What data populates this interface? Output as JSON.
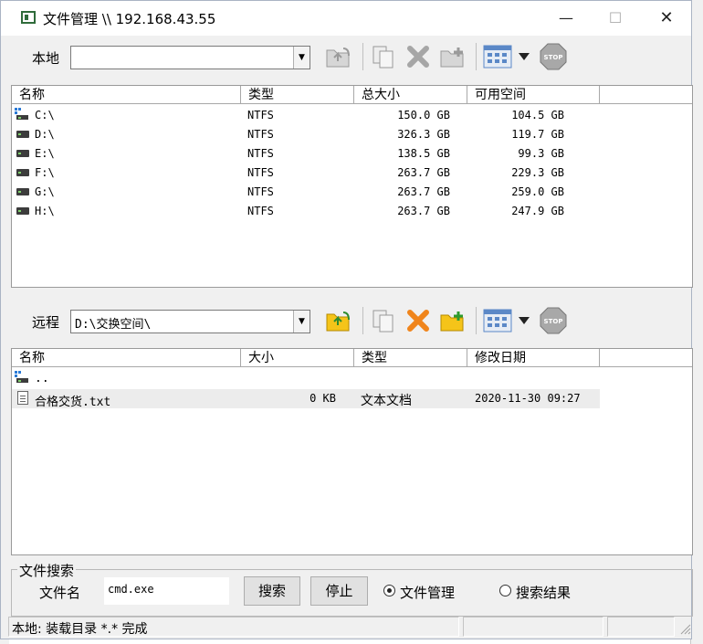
{
  "window": {
    "title": "文件管理 \\\\ 192.168.43.55",
    "minimize": "—",
    "maximize": "☐",
    "close": "✕"
  },
  "local": {
    "label": "本地",
    "path": "",
    "columns": [
      "名称",
      "类型",
      "总大小",
      "可用空间"
    ],
    "rows": [
      {
        "name": "C:\\",
        "type": "NTFS",
        "total": "150.0 GB",
        "free": "104.5 GB",
        "icon": "network-drive-icon"
      },
      {
        "name": "D:\\",
        "type": "NTFS",
        "total": "326.3 GB",
        "free": "119.7 GB",
        "icon": "drive-icon"
      },
      {
        "name": "E:\\",
        "type": "NTFS",
        "total": "138.5 GB",
        "free": "99.3 GB",
        "icon": "drive-icon"
      },
      {
        "name": "F:\\",
        "type": "NTFS",
        "total": "263.7 GB",
        "free": "229.3 GB",
        "icon": "drive-icon"
      },
      {
        "name": "G:\\",
        "type": "NTFS",
        "total": "263.7 GB",
        "free": "259.0 GB",
        "icon": "drive-icon"
      },
      {
        "name": "H:\\",
        "type": "NTFS",
        "total": "263.7 GB",
        "free": "247.9 GB",
        "icon": "drive-icon"
      }
    ]
  },
  "remote": {
    "label": "远程",
    "path": "D:\\交换空间\\",
    "columns": [
      "名称",
      "大小",
      "类型",
      "修改日期"
    ],
    "rows": [
      {
        "name": "..",
        "size": "",
        "type": "",
        "date": "",
        "icon": "parent-folder-icon"
      },
      {
        "name": "合格交货.txt",
        "size": "0 KB",
        "type": "文本文档",
        "date": "2020-11-30 09:27",
        "icon": "text-file-icon"
      }
    ]
  },
  "toolbar_icons": [
    "folder-up-icon",
    "copy-icon",
    "delete-icon",
    "new-folder-icon",
    "view-icon",
    "stop-icon"
  ],
  "search": {
    "legend": "文件搜索",
    "filename_label": "文件名",
    "filename_value": "cmd.exe",
    "search_button": "搜索",
    "stop_button": "停止",
    "radio_file_manager": "文件管理",
    "radio_search_results": "搜索结果",
    "selected": "文件管理"
  },
  "status": {
    "text": "本地: 装载目录 *.* 完成"
  },
  "stop_icon_text": "STOP",
  "colors": {
    "icon_folder_active": "#f5c419",
    "icon_delete_active": "#f0851c",
    "icon_gray": "#bdbdbd",
    "view_icon_blue": "#5b88c7"
  }
}
